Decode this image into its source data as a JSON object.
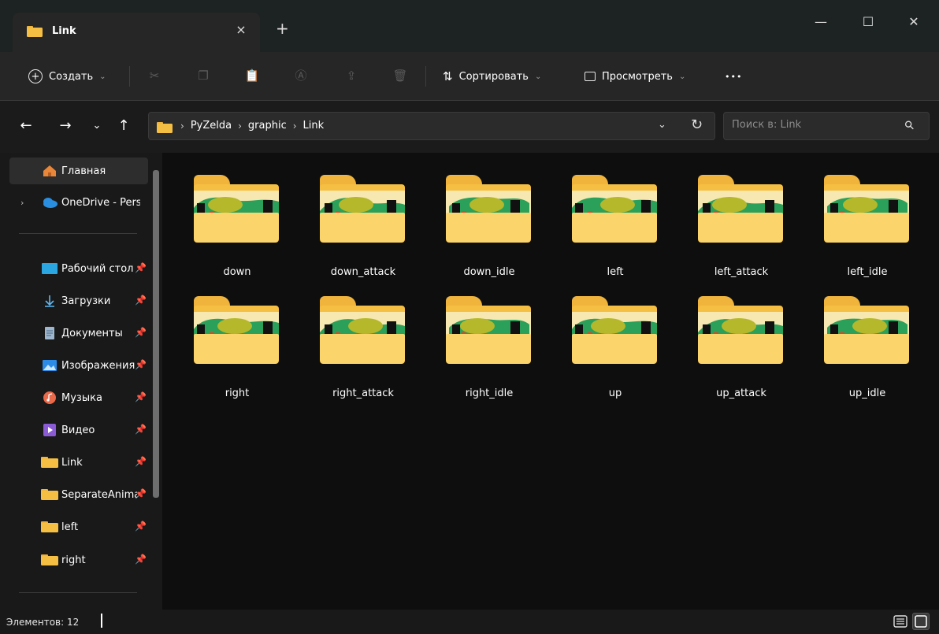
{
  "window": {
    "tab_title": "Link",
    "tab_close": "×",
    "new_tab": "+",
    "minimize": "—",
    "maximize": "☐",
    "close": "✕"
  },
  "toolbar": {
    "create_label": "Создать",
    "sort_label": "Сортировать",
    "view_label": "Просмотреть",
    "more_label": "•••"
  },
  "address": {
    "crumbs": [
      "PyZelda",
      "graphic",
      "Link"
    ]
  },
  "search": {
    "placeholder": "Поиск в: Link"
  },
  "sidebar": {
    "items": [
      {
        "label": "Главная",
        "icon": "home-icon",
        "color": "#e8873a"
      },
      {
        "label": "OneDrive - Personal",
        "icon": "onedrive-icon",
        "color": "#2a8fe0"
      },
      {
        "label": "Рабочий стол",
        "icon": "desktop-icon",
        "color": "#2ca6e0"
      },
      {
        "label": "Загрузки",
        "icon": "download-icon",
        "color": "#5fb8f0"
      },
      {
        "label": "Документы",
        "icon": "documents-icon",
        "color": "#9fb6cf"
      },
      {
        "label": "Изображения",
        "icon": "pictures-icon",
        "color": "#2b8be6"
      },
      {
        "label": "Музыка",
        "icon": "music-icon",
        "color": "#e86a4a"
      },
      {
        "label": "Видео",
        "icon": "video-icon",
        "color": "#8b5bd6"
      },
      {
        "label": "Link",
        "icon": "folder-icon",
        "color": "#f5bf43"
      },
      {
        "label": "SeparateAnimations",
        "icon": "folder-icon",
        "color": "#f5bf43"
      },
      {
        "label": "left",
        "icon": "folder-icon",
        "color": "#f5bf43"
      },
      {
        "label": "right",
        "icon": "folder-icon",
        "color": "#f5bf43"
      }
    ]
  },
  "folders": [
    {
      "name": "down"
    },
    {
      "name": "down_attack"
    },
    {
      "name": "down_idle"
    },
    {
      "name": "left"
    },
    {
      "name": "left_attack"
    },
    {
      "name": "left_idle"
    },
    {
      "name": "right"
    },
    {
      "name": "right_attack"
    },
    {
      "name": "right_idle"
    },
    {
      "name": "up"
    },
    {
      "name": "up_attack"
    },
    {
      "name": "up_idle"
    }
  ],
  "status": {
    "count_text": "Элементов: 12"
  },
  "colors": {
    "folder": "#f5bf43",
    "folder_front": "#fbd46c",
    "sprite_green": "#2aa05a",
    "sprite_olive": "#b5b82a",
    "accent": "#4cc2ff"
  }
}
